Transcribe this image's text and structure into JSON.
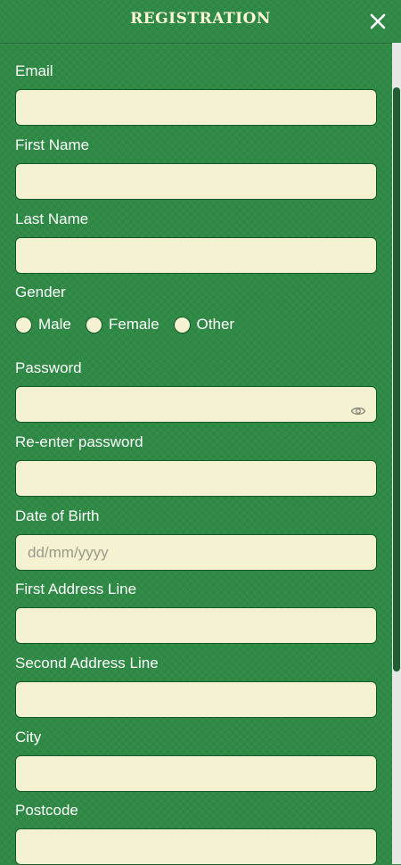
{
  "header": {
    "title": "REGISTRATION"
  },
  "fields": {
    "email": {
      "label": "Email",
      "value": ""
    },
    "first_name": {
      "label": "First Name",
      "value": ""
    },
    "last_name": {
      "label": "Last Name",
      "value": ""
    },
    "gender": {
      "label": "Gender",
      "options": [
        "Male",
        "Female",
        "Other"
      ],
      "selected": null
    },
    "password": {
      "label": "Password",
      "value": "",
      "icon": "eye-icon"
    },
    "reenter_password": {
      "label": "Re-enter password",
      "value": ""
    },
    "dob": {
      "label": "Date of Birth",
      "placeholder": "dd/mm/yyyy",
      "value": ""
    },
    "address1": {
      "label": "First Address Line",
      "value": ""
    },
    "address2": {
      "label": "Second Address Line",
      "value": ""
    },
    "city": {
      "label": "City",
      "value": ""
    },
    "postcode": {
      "label": "Postcode",
      "value": ""
    }
  },
  "colors": {
    "background": "#2f8a45",
    "input_bg": "#f4f2d0",
    "title_text": "#fff8d8",
    "label_text": "#ffffff"
  }
}
